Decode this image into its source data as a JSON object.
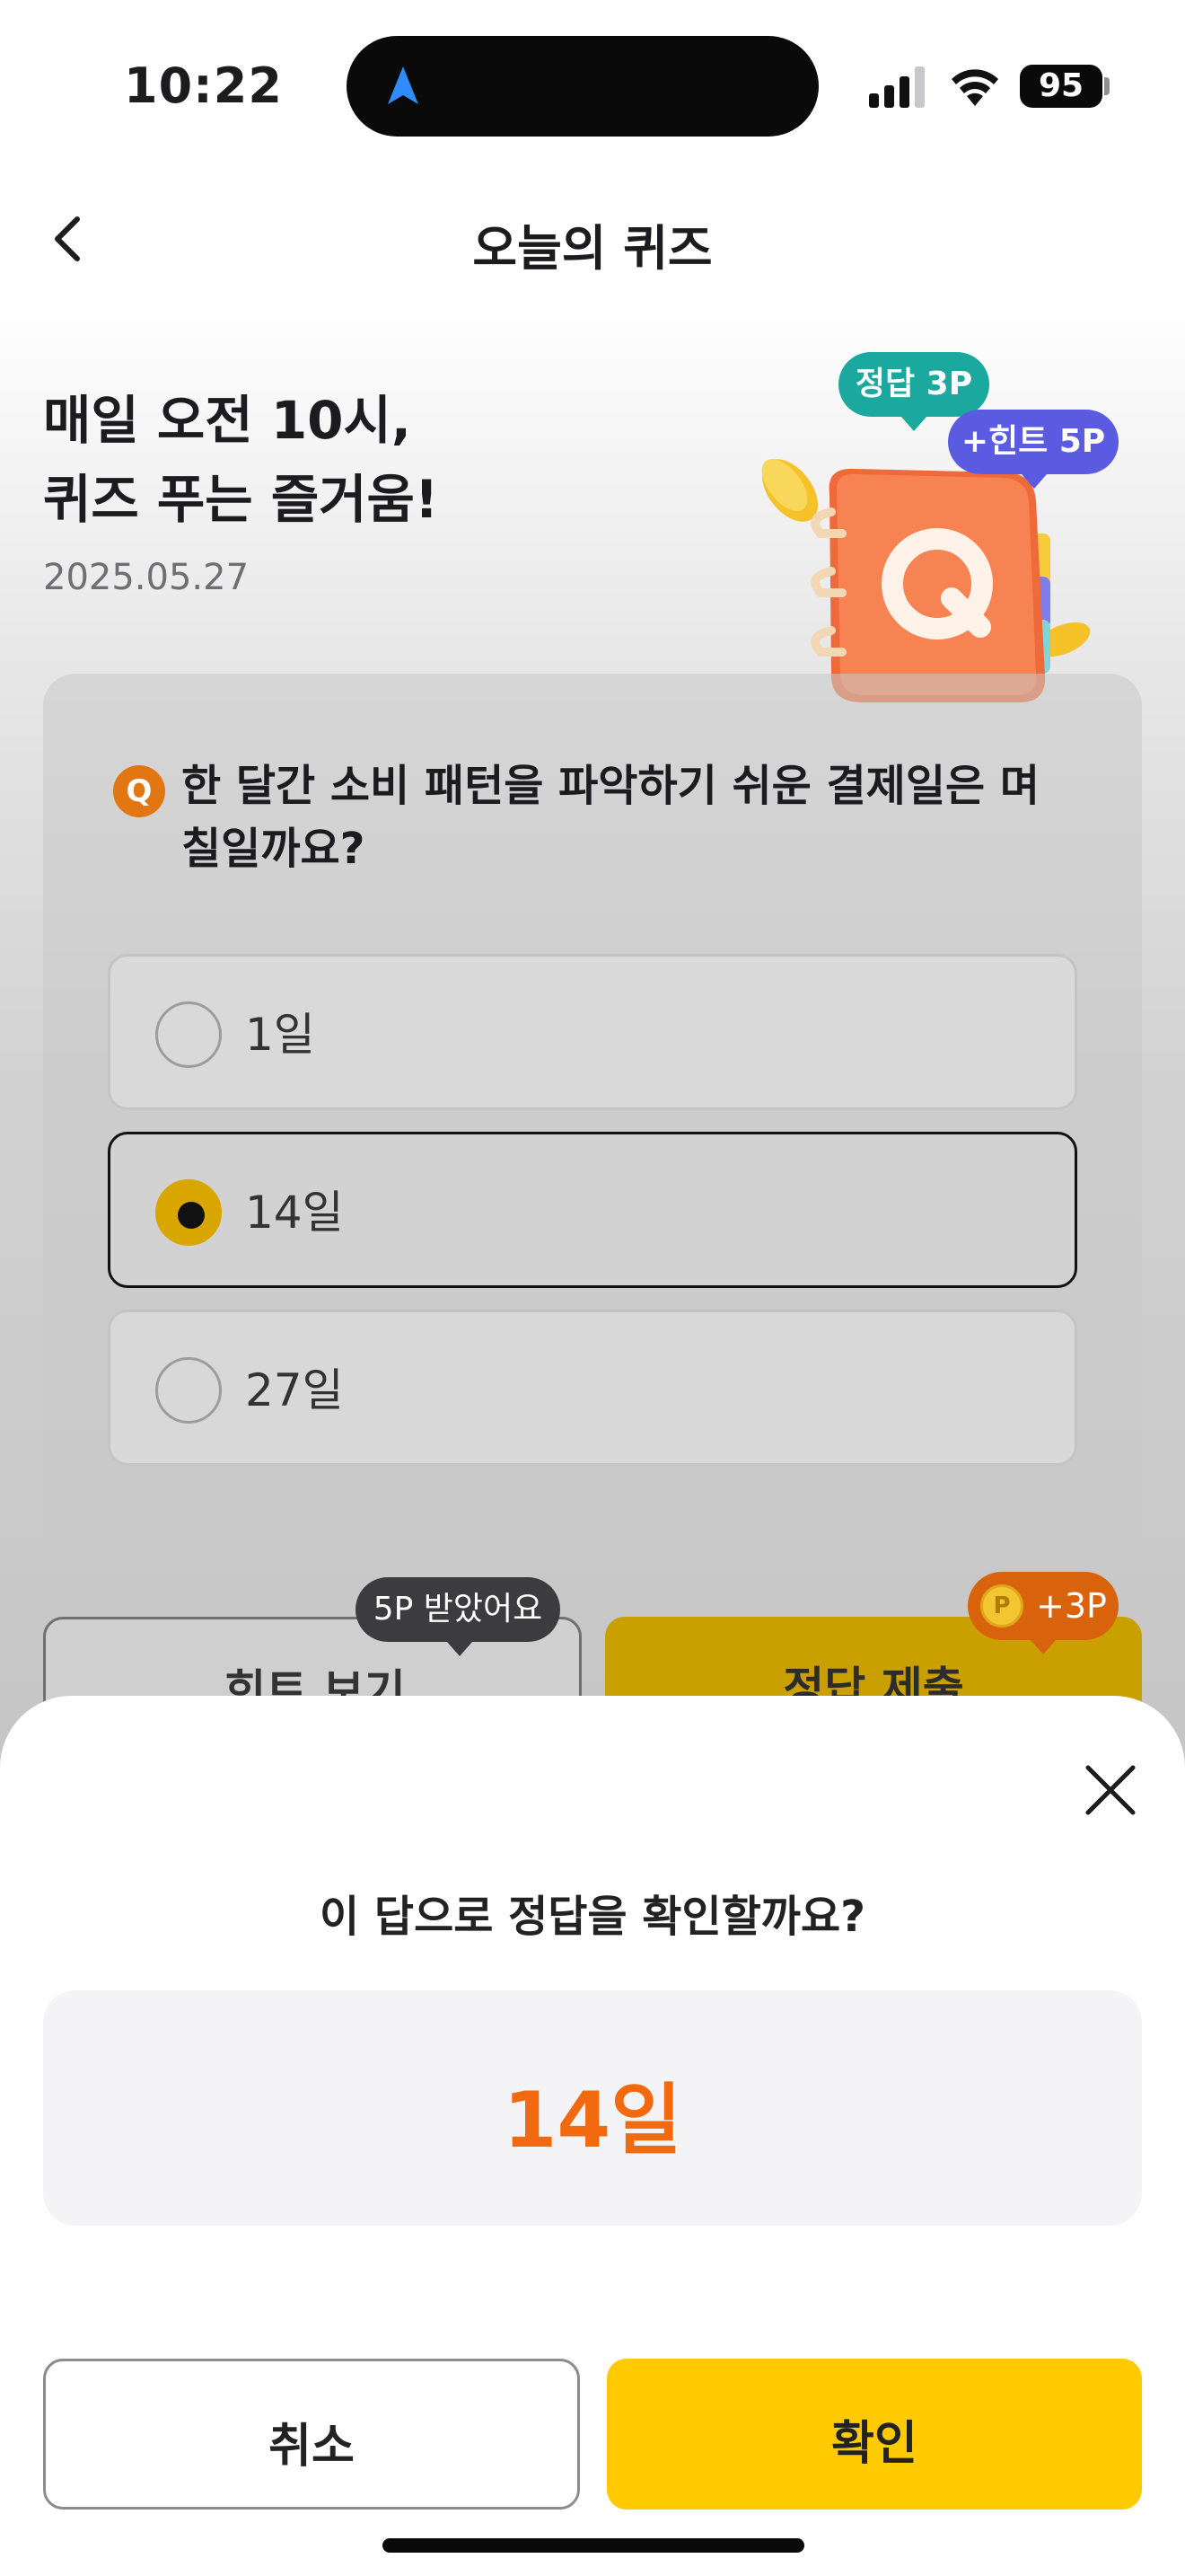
{
  "status_bar": {
    "time": "10:22",
    "battery": "95"
  },
  "header": {
    "title": "오늘의 퀴즈"
  },
  "hero": {
    "title": "매일 오전 10시,\n퀴즈 푸는 즐거움!",
    "date": "2025.05.27",
    "bubble_correct": "정답 3P",
    "bubble_hint": "+힌트 5P",
    "book_letter": "Q"
  },
  "quiz": {
    "badge": "Q",
    "question": "한 달간 소비 패턴을 파악하기 쉬운 결제일은 며칠일까요?",
    "options": [
      {
        "label": "1일",
        "selected": false
      },
      {
        "label": "14일",
        "selected": true
      },
      {
        "label": "27일",
        "selected": false
      }
    ]
  },
  "actions": {
    "hint_label": "힌트 보기",
    "hint_tooltip": "5P 받았어요",
    "submit_label": "정답 제출",
    "submit_tooltip": "+3P",
    "coin_letter": "P"
  },
  "sheet": {
    "question": "이 답으로 정답을 확인할까요?",
    "answer": "14일",
    "cancel_label": "취소",
    "confirm_label": "확인"
  },
  "colors": {
    "accent_yellow": "#ffcb00",
    "answer_orange": "#f26a10",
    "teal": "#1ba89e",
    "purple": "#5a5be0"
  }
}
